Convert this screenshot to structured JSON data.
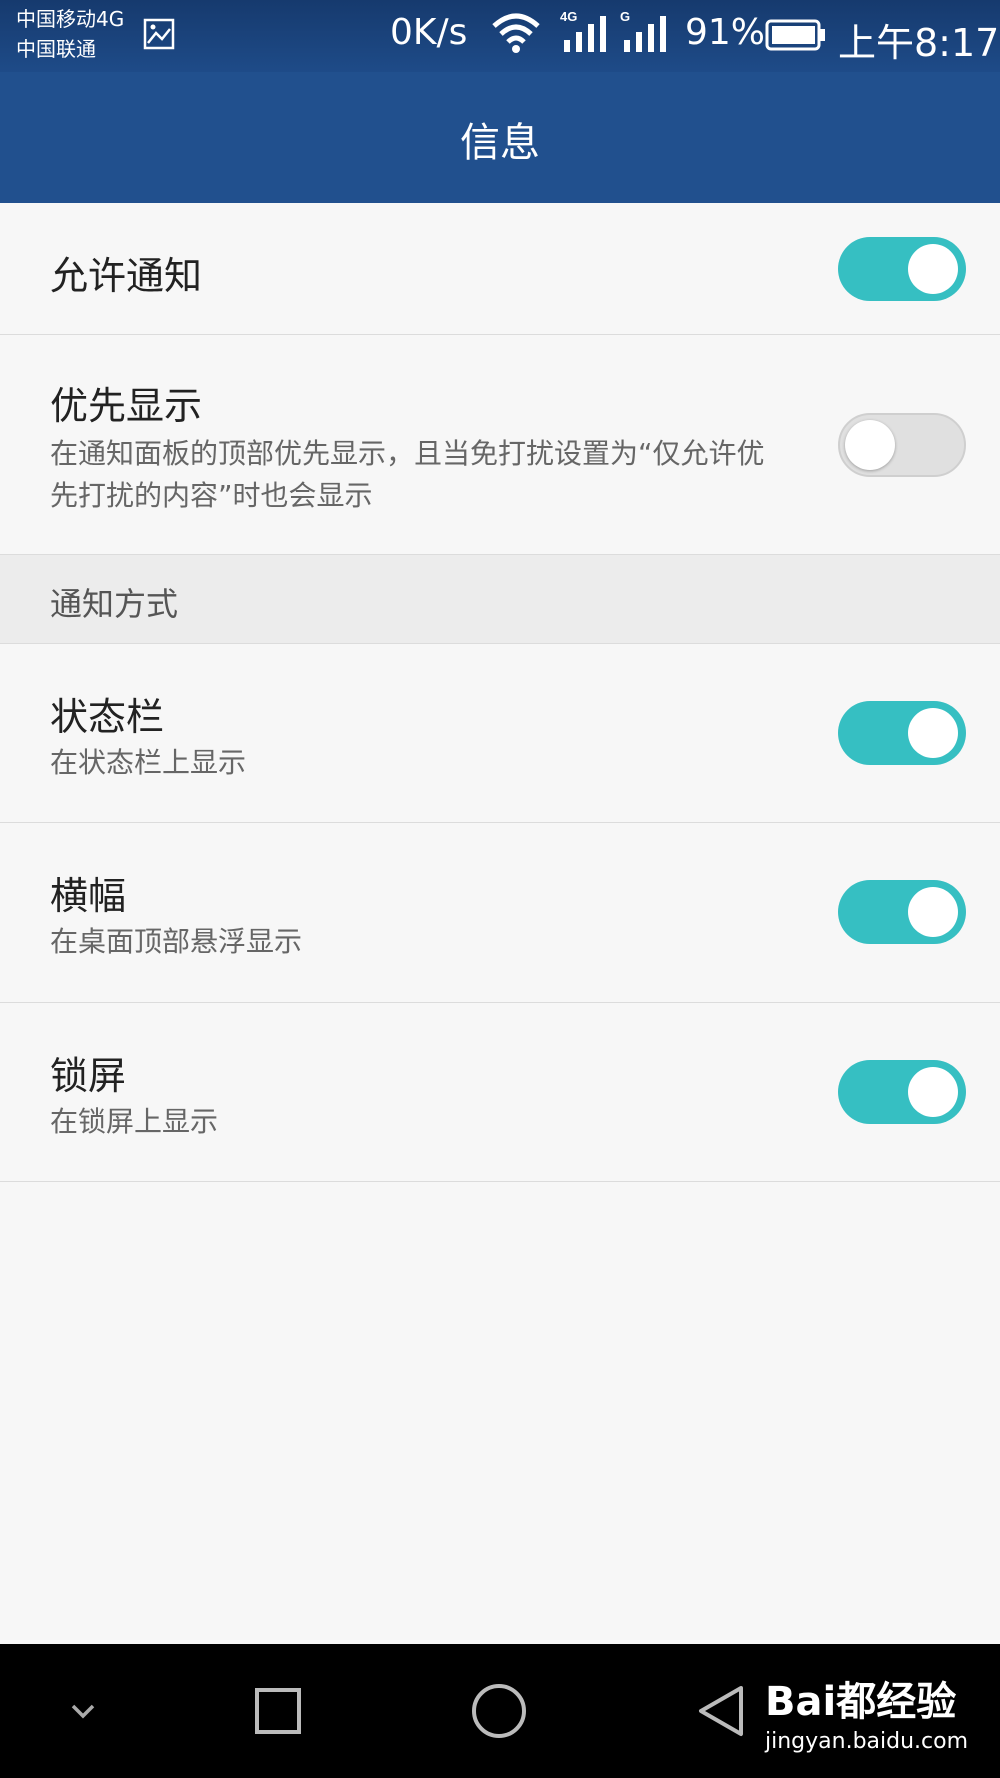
{
  "status_bar": {
    "carrier_1": "中国移动4G",
    "carrier_2": "中国联通",
    "net_speed": "0K/s",
    "sig1_label": "4G",
    "sig2_label": "G",
    "battery": "91%",
    "time": "上午8:17"
  },
  "app_bar": {
    "title": "信息"
  },
  "rows": [
    {
      "title": "允许通知",
      "subtitle": "",
      "enabled": true
    },
    {
      "title": "优先显示",
      "subtitle": "在通知面板的顶部优先显示，且当免打扰设置为“仅允许优先打扰的内容”时也会显示",
      "enabled": false
    },
    {
      "title": "状态栏",
      "subtitle": "在状态栏上显示",
      "enabled": true
    },
    {
      "title": "横幅",
      "subtitle": "在桌面顶部悬浮显示",
      "enabled": true
    },
    {
      "title": "锁屏",
      "subtitle": "在锁屏上显示",
      "enabled": true
    }
  ],
  "section": {
    "label": "通知方式"
  },
  "watermark": {
    "logo": "Bai都经验",
    "url": "jingyan.baidu.com"
  },
  "colors": {
    "accent": "#36bfc2",
    "app_bar": "#21508e",
    "background": "#f7f7f7"
  }
}
